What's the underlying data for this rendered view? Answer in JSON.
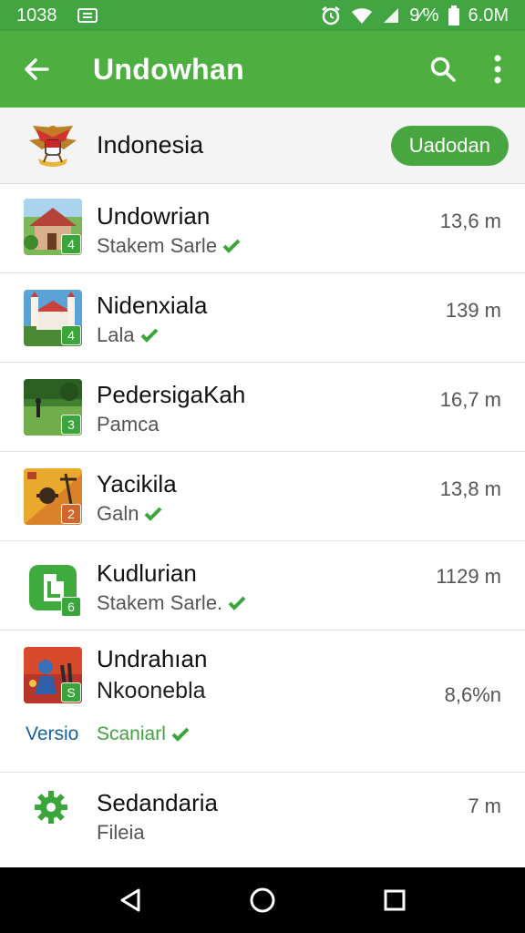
{
  "status_bar": {
    "time": "1038",
    "battery_text": "9⁄%",
    "data_text": "6.0M"
  },
  "app_bar": {
    "title": "Undowhan"
  },
  "header": {
    "country": "Indonesia",
    "button_label": "Uadodan"
  },
  "items": [
    {
      "name": "Undowrian",
      "sub": "Stakem Sarle",
      "verified": true,
      "size": "13,6 m",
      "badge": "4"
    },
    {
      "name": "Nidenxiala",
      "sub": "Lala",
      "verified": true,
      "size": "139 m",
      "badge": "4"
    },
    {
      "name": "PedersigaKah",
      "sub": "Pamca",
      "verified": false,
      "size": "16,7 m",
      "badge": "3"
    },
    {
      "name": "Yacikila",
      "sub": "Galn",
      "verified": true,
      "size": "13,8 m",
      "badge": "2"
    },
    {
      "name": "Kudlurian",
      "sub": "Stakem Sarle.",
      "verified": true,
      "size": "1129 m",
      "badge": "6"
    },
    {
      "name": "Undrahıan",
      "sub": "Nkoonebla",
      "verified": false,
      "size": "8,6%n",
      "badge": "S",
      "version": "Versio",
      "scan": "Scaniarl"
    },
    {
      "name": "Sedandaria",
      "sub": "Fileia",
      "verified": false,
      "size": "7 m"
    }
  ],
  "colors": {
    "app_bar": "#4caf3f",
    "status_bar": "#41a541",
    "accent": "#47a63f",
    "version_text": "#1b5e9b"
  },
  "icons": {
    "back": "arrow-back-icon",
    "search": "search-icon",
    "more": "more-vert-icon",
    "nav_back": "nav-back-icon",
    "nav_home": "nav-home-icon",
    "nav_recents": "nav-recents-icon"
  }
}
